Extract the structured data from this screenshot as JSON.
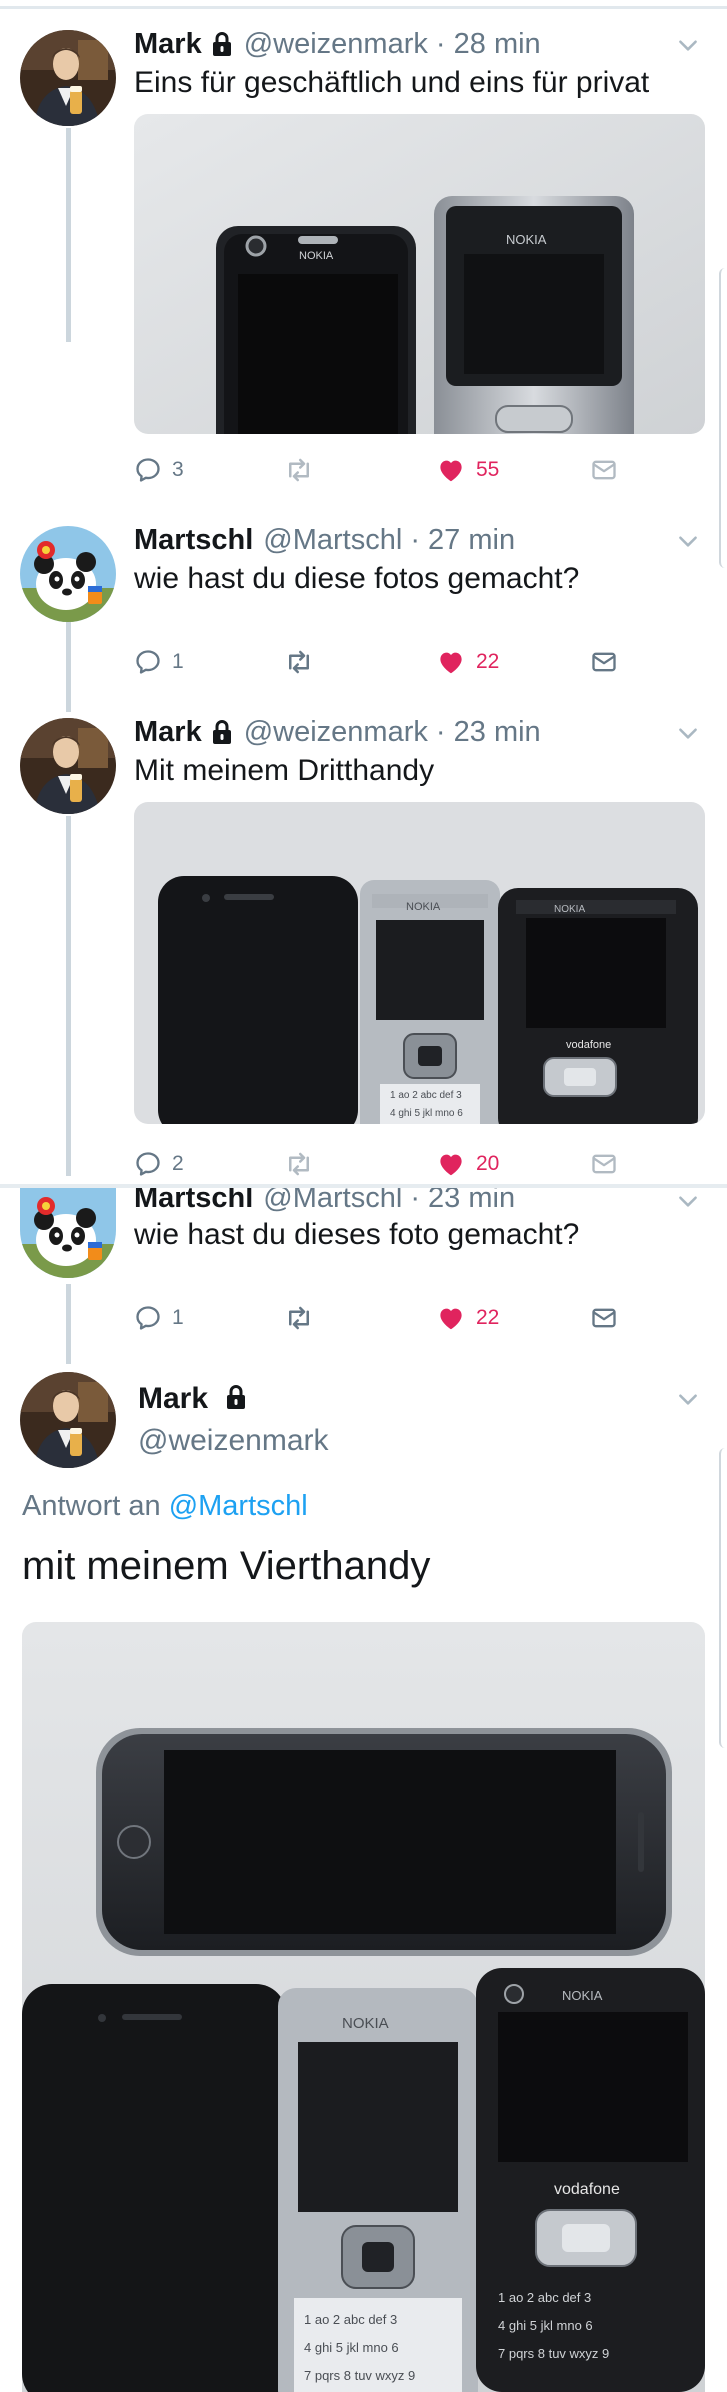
{
  "colors": {
    "accent": "#1da1f2",
    "like": "#e0245e",
    "secondary": "#657786",
    "divider": "#e1e8ed"
  },
  "tweets": [
    {
      "name": "Mark",
      "protected": true,
      "handle": "@weizenmark · 28 min",
      "text": "Eins für geschäftlich und eins für privat",
      "replies": "3",
      "retweets": "",
      "likes": "55",
      "liked": true,
      "has_media": true
    },
    {
      "name": "Martschl",
      "protected": false,
      "handle": "@Martschl · 27 min",
      "text": "wie hast du diese fotos gemacht?",
      "replies": "1",
      "retweets": "",
      "likes": "22",
      "liked": true,
      "has_media": false
    },
    {
      "name": "Mark",
      "protected": true,
      "handle": "@weizenmark · 23 min",
      "text": "Mit meinem Dritthandy",
      "replies": "2",
      "retweets": "",
      "likes": "20",
      "liked": true,
      "has_media": true
    },
    {
      "name": "Martschl",
      "protected": false,
      "handle": "@Martschl · 23 min",
      "text": "wie hast du dieses foto gemacht?",
      "replies": "1",
      "retweets": "",
      "likes": "22",
      "liked": true,
      "has_media": false
    }
  ],
  "main_tweet": {
    "name": "Mark",
    "handle": "@weizenmark",
    "reply_prefix": "Antwort an",
    "reply_mention": "@Martschl",
    "text": "mit meinem Vierthandy"
  },
  "photo_labels": {
    "nokia": "NOKIA",
    "vodafone": "vodafone"
  },
  "icons": [
    "reply-icon",
    "retweet-icon",
    "heart-icon",
    "dm-icon",
    "lock-icon",
    "caret-down-icon"
  ]
}
